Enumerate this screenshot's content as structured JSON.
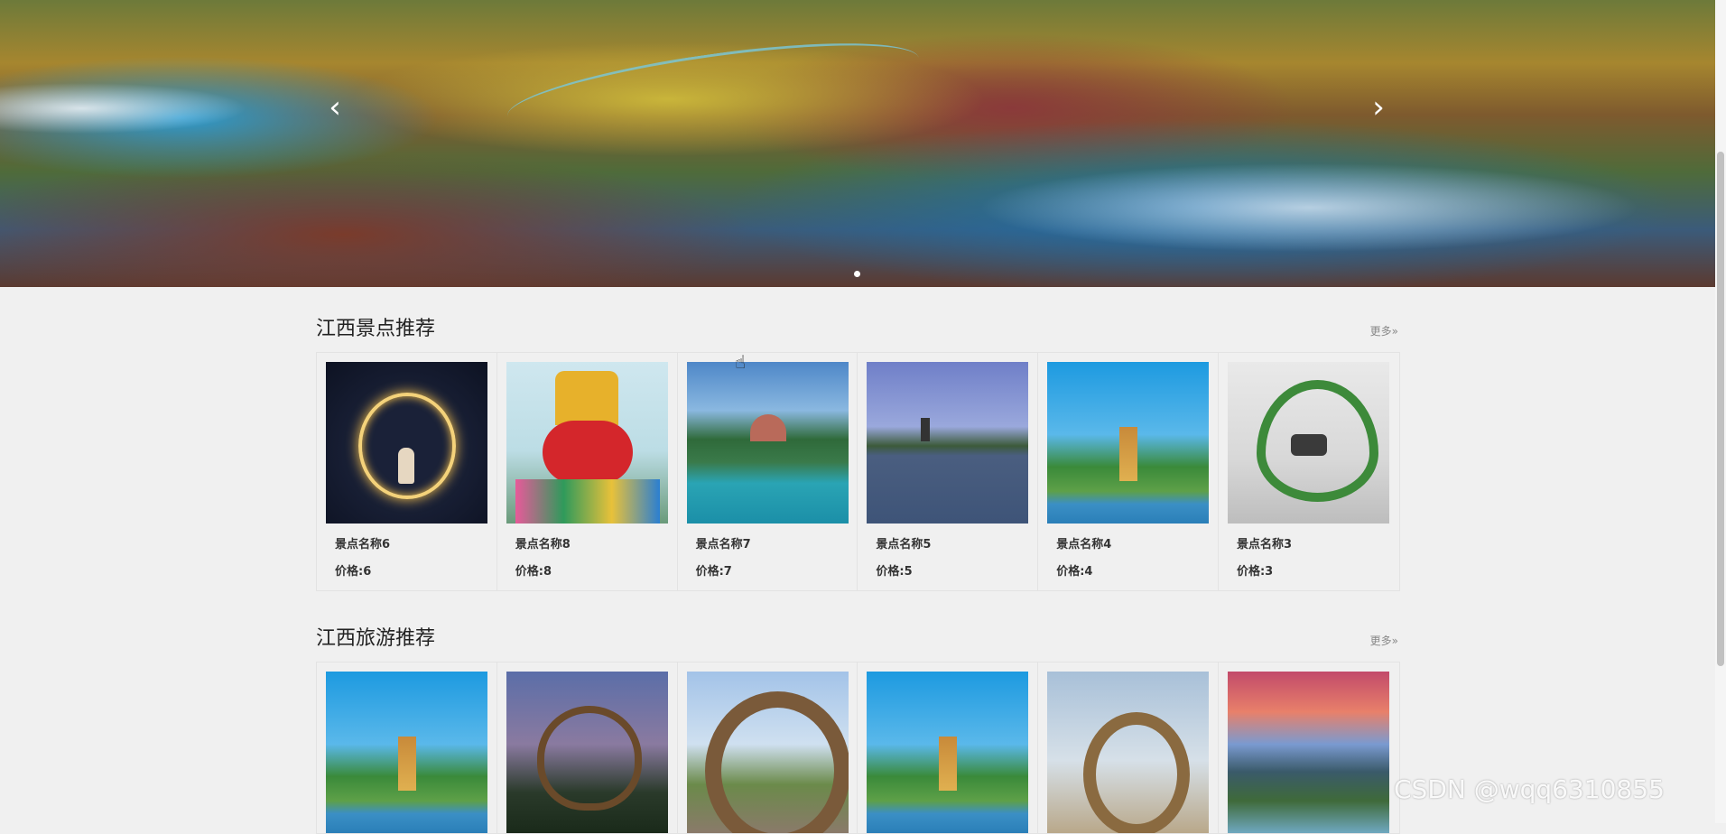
{
  "banner": {
    "prev_icon": "chevron-left-icon",
    "next_icon": "chevron-right-icon",
    "prev_glyph": "‹",
    "next_glyph": "›",
    "slide_count_shown": 1
  },
  "sections": [
    {
      "title": "江西景点推荐",
      "more_label": "更多»",
      "items": [
        {
          "name": "景点名称6",
          "price": "价格:6"
        },
        {
          "name": "景点名称8",
          "price": "价格:8"
        },
        {
          "name": "景点名称7",
          "price": "价格:7"
        },
        {
          "name": "景点名称5",
          "price": "价格:5"
        },
        {
          "name": "景点名称4",
          "price": "价格:4"
        },
        {
          "name": "景点名称3",
          "price": "价格:3"
        }
      ]
    },
    {
      "title": "江西旅游推荐",
      "more_label": "更多»",
      "items": [
        {
          "name": "",
          "price": ""
        },
        {
          "name": "",
          "price": ""
        },
        {
          "name": "",
          "price": ""
        },
        {
          "name": "",
          "price": ""
        },
        {
          "name": "",
          "price": ""
        },
        {
          "name": "",
          "price": ""
        }
      ]
    }
  ],
  "watermark": "CSDN @wqq6310855"
}
